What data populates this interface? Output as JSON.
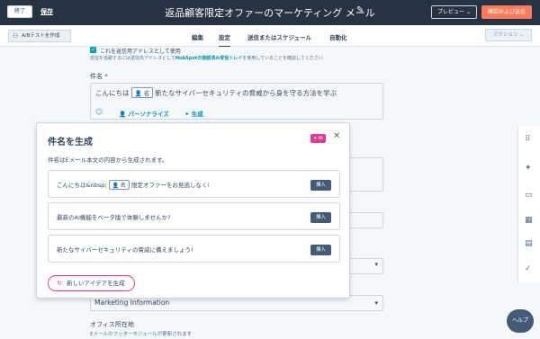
{
  "topbar": {
    "exit_label": "終了",
    "save_label": "保存",
    "title": "返品顧客限定オファーのマーケティング メール",
    "pencil_icon": "pencil-icon",
    "preview_label": "プレビュー ⌄",
    "send_label": "確認および送信"
  },
  "tabbar": {
    "ab_label": "A/Bテストを作成",
    "tabs": [
      "編集",
      "設定",
      "送信またはスケジュール",
      "自動化"
    ],
    "active_tab": "設定",
    "action_label": "アクション ⌄"
  },
  "settings": {
    "checkbox_label": "これを返信用アドレスとして使用",
    "hint_prefix": "返信を追跡するには返信先アドレスとして",
    "hint_link": "HubSpotの接続済み受信トレイ",
    "hint_suffix": "を使用していることを確認してください",
    "subject_label": "件名 *",
    "subject_pre": "こんにちは",
    "subject_token": "名",
    "subject_post": "新たなサイバーセキュリティの脅威から身を守る方法を学ぶ",
    "personalize_label": "パーソナライズ",
    "generate_label": "生成",
    "select_value": "Marketing Information",
    "office_label": "オフィス所在地",
    "office_hint": "Eメールのフッターモジュールが更新されます"
  },
  "modal": {
    "title": "件名を生成",
    "ai_badge": "✦ AI",
    "description": "件名はEメール本文の内容から生成されます。",
    "suggestions": [
      {
        "pre": "こんにちは&nbsp;",
        "token": "名",
        "post": "限定オファーをお見逃しなく!"
      },
      {
        "text": "最新のAI機能をベータ版で体験しませんか?"
      },
      {
        "text": "新たなサイバーセキュリティの脅威に備えましょう!"
      }
    ],
    "insert_label": "挿入",
    "new_ideas_label": "新しいアイデアを生成"
  },
  "help_label": "ヘルプ"
}
